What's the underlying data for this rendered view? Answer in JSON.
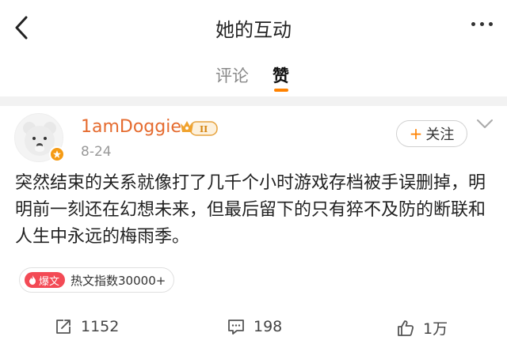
{
  "header": {
    "title": "她的互动",
    "back_icon": "chevron-left-icon",
    "more_icon": "more-dots-icon"
  },
  "tabs": [
    {
      "label": "评论",
      "active": false
    },
    {
      "label": "赞",
      "active": true
    }
  ],
  "accent_color": "#ff8200",
  "post": {
    "username": "1amDoggie",
    "username_color": "#e56b2f",
    "member_badge": "II",
    "date": "8-24",
    "follow_label": "关注",
    "content": "突然结束的关系就像打了几千个小时游戏存档被手误删掉，明明前一刻还在幻想未来，但最后留下的只有猝不及防的断联和人生中永远的梅雨季。",
    "hot_tag": {
      "pill": "爆文",
      "text": "热文指数30000+",
      "color": "#f34a55"
    },
    "actions": {
      "repost": "1152",
      "comment": "198",
      "like": "1万"
    }
  }
}
